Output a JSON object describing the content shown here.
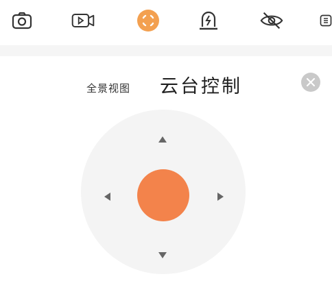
{
  "toolbar": {
    "items": [
      {
        "icon": "camera-icon"
      },
      {
        "icon": "video-record-icon"
      },
      {
        "icon": "ptz-control-icon",
        "active": true
      },
      {
        "icon": "alarm-light-icon"
      },
      {
        "icon": "privacy-eye-off-icon"
      },
      {
        "icon": "more-icon"
      }
    ],
    "accent_color": "#f3a050"
  },
  "header": {
    "tab_panorama": "全景视图",
    "tab_ptz": "云台控制",
    "close_icon": "close-icon"
  },
  "ptz_pad": {
    "center_color": "#f3834b",
    "pad_color": "#f4f4f4",
    "arrows": [
      "up",
      "down",
      "left",
      "right"
    ]
  }
}
